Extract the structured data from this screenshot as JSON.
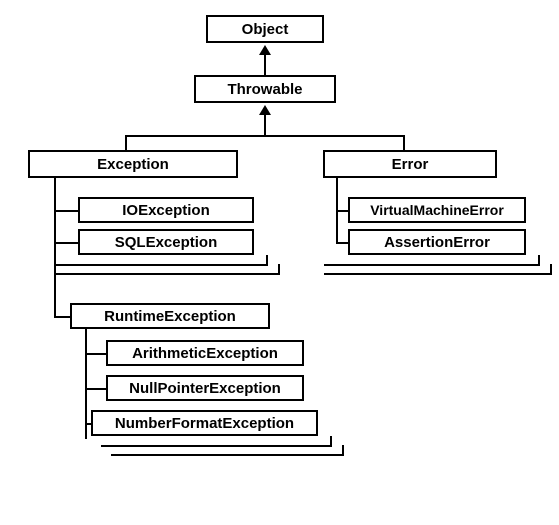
{
  "hierarchy": {
    "root": "Object",
    "throwable": "Throwable",
    "exception": "Exception",
    "error": "Error",
    "ioException": "IOException",
    "sqlException": "SQLException",
    "runtimeException": "RuntimeException",
    "arithmeticException": "ArithmeticException",
    "nullPointerException": "NullPointerException",
    "numberFormatException": "NumberFormatException",
    "virtualMachineError": "VirtualMachineError",
    "assertionError": "AssertionError"
  }
}
